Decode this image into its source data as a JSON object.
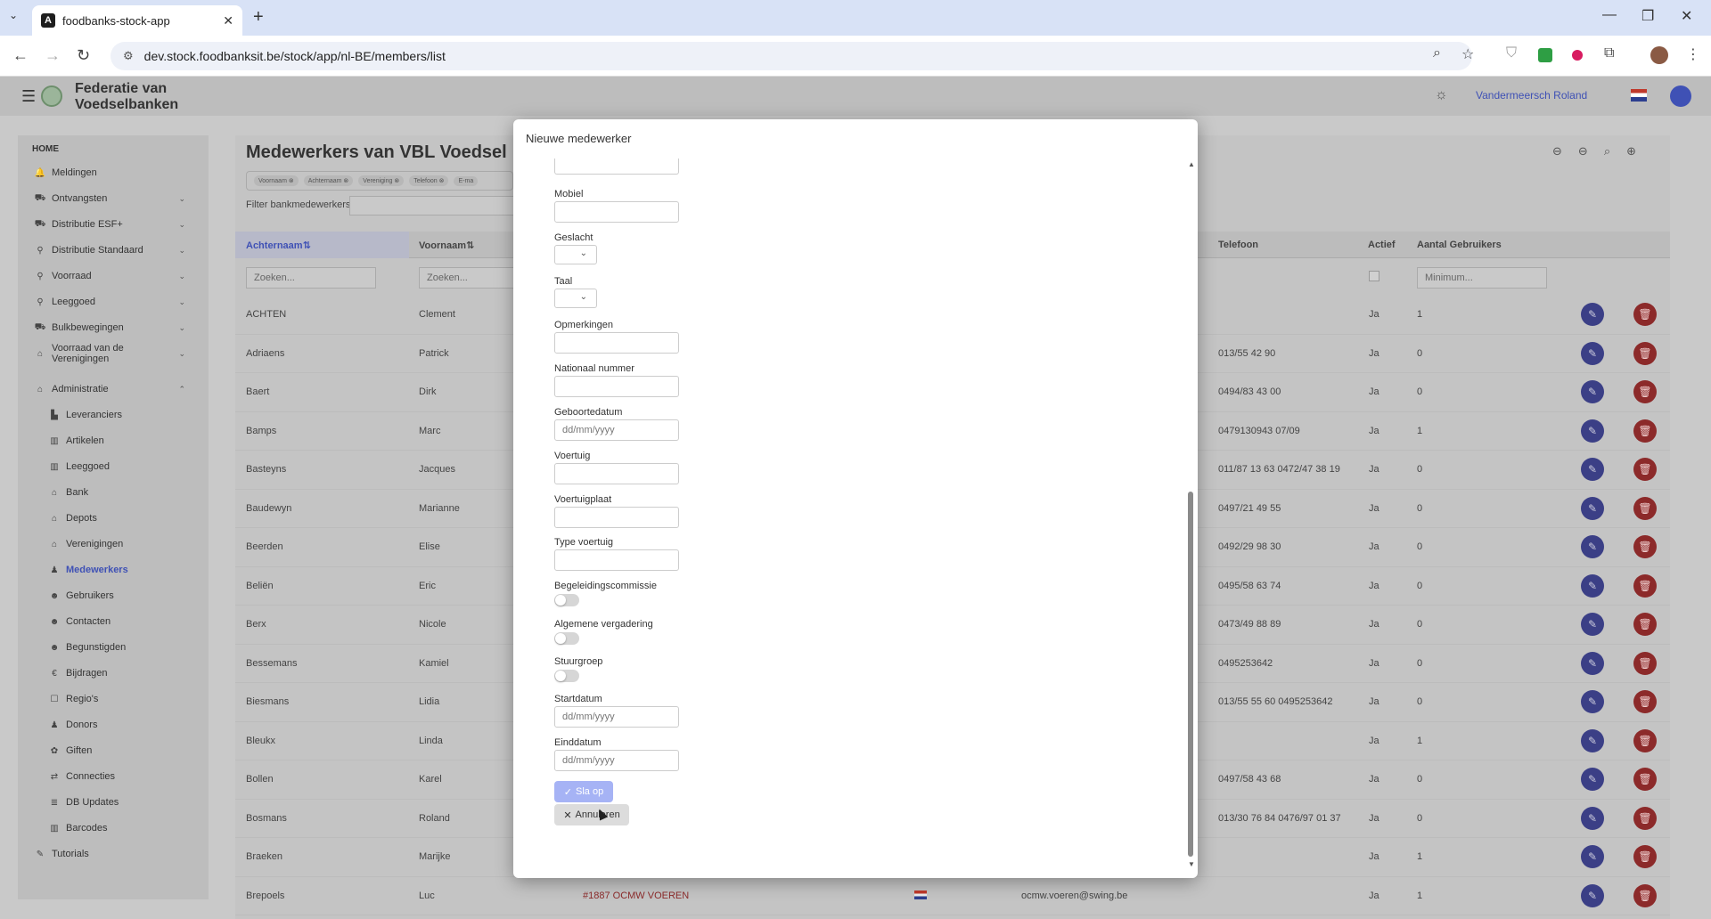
{
  "browser": {
    "tab_title": "foodbanks-stock-app",
    "tab_icon": "A",
    "url": "dev.stock.foodbanksit.be/stock/app/nl-BE/members/list"
  },
  "app": {
    "brand": "Federatie van Voedselbanken",
    "user_name": "Vandermeersch Roland"
  },
  "sidebar": {
    "home": "HOME",
    "items": [
      {
        "label": "Meldingen",
        "icon": "bell-icon",
        "chev": ""
      },
      {
        "label": "Ontvangsten",
        "icon": "truck-in-icon",
        "chev": "⌄"
      },
      {
        "label": "Distributie ESF+",
        "icon": "truck-icon",
        "chev": "⌄"
      },
      {
        "label": "Distributie Standaard",
        "icon": "dolly-icon",
        "chev": "⌄"
      },
      {
        "label": "Voorraad",
        "icon": "dolly-icon",
        "chev": "⌄"
      },
      {
        "label": "Leeggoed",
        "icon": "dolly-icon",
        "chev": "⌄"
      },
      {
        "label": "Bulkbewegingen",
        "icon": "truck-icon",
        "chev": "⌄"
      },
      {
        "label": "Voorraad van de Verenigingen",
        "icon": "warehouse-icon",
        "chev": "⌄"
      },
      {
        "label": "Administratie",
        "icon": "admin-icon",
        "chev": "⌃"
      },
      {
        "label": "Leveranciers",
        "icon": "industry-icon",
        "chev": ""
      },
      {
        "label": "Artikelen",
        "icon": "barcode-icon",
        "chev": ""
      },
      {
        "label": "Leeggoed",
        "icon": "barcode-icon",
        "chev": ""
      },
      {
        "label": "Bank",
        "icon": "warehouse-icon",
        "chev": ""
      },
      {
        "label": "Depots",
        "icon": "warehouse-icon",
        "chev": ""
      },
      {
        "label": "Verenigingen",
        "icon": "warehouse-icon",
        "chev": ""
      },
      {
        "label": "Medewerkers",
        "icon": "person-icon",
        "chev": ""
      },
      {
        "label": "Gebruikers",
        "icon": "users-icon",
        "chev": ""
      },
      {
        "label": "Contacten",
        "icon": "users-icon",
        "chev": ""
      },
      {
        "label": "Begunstigden",
        "icon": "users-icon",
        "chev": ""
      },
      {
        "label": "Bijdragen",
        "icon": "euro-icon",
        "chev": ""
      },
      {
        "label": "Regio's",
        "icon": "square-icon",
        "chev": ""
      },
      {
        "label": "Donors",
        "icon": "person-icon",
        "chev": ""
      },
      {
        "label": "Giften",
        "icon": "gift-icon",
        "chev": ""
      },
      {
        "label": "Connecties",
        "icon": "link-icon",
        "chev": ""
      },
      {
        "label": "DB Updates",
        "icon": "database-icon",
        "chev": ""
      },
      {
        "label": "Barcodes",
        "icon": "barcode-icon",
        "chev": ""
      },
      {
        "label": "Tutorials",
        "icon": "tutorial-icon",
        "chev": ""
      }
    ]
  },
  "main": {
    "title": "Medewerkers van VBL Voedsel",
    "chips": [
      "Voornaam",
      "Achternaam",
      "Vereniging",
      "Telefoon",
      "E-ma"
    ],
    "filter_label": "Filter bankmedewerkers",
    "columns": {
      "lastname": "Achternaam",
      "firstname": "Voornaam",
      "phone": "Telefoon",
      "active": "Actief",
      "users": "Aantal Gebruikers"
    },
    "search_placeholder": "Zoeken...",
    "min_placeholder": "Minimum...",
    "rows": [
      {
        "last": "ACHTEN",
        "first": "Clement",
        "phone": "",
        "active": "Ja",
        "users": "1"
      },
      {
        "last": "Adriaens",
        "first": "Patrick",
        "phone": "013/55 42 90",
        "active": "Ja",
        "users": "0"
      },
      {
        "last": "Baert",
        "first": "Dirk",
        "phone": "0494/83 43 00",
        "active": "Ja",
        "users": "0"
      },
      {
        "last": "Bamps",
        "first": "Marc",
        "phone": "0479130943 07/09",
        "active": "Ja",
        "users": "1"
      },
      {
        "last": "Basteyns",
        "first": "Jacques",
        "phone": "011/87 13 63 0472/47 38 19",
        "active": "Ja",
        "users": "0"
      },
      {
        "last": "Baudewyn",
        "first": "Marianne",
        "phone": "0497/21 49 55",
        "active": "Ja",
        "users": "0"
      },
      {
        "last": "Beerden",
        "first": "Elise",
        "phone": "0492/29 98 30",
        "active": "Ja",
        "users": "0"
      },
      {
        "last": "Beliën",
        "first": "Eric",
        "phone": "0495/58 63 74",
        "active": "Ja",
        "users": "0"
      },
      {
        "last": "Berx",
        "first": "Nicole",
        "phone": "0473/49 88 89",
        "active": "Ja",
        "users": "0"
      },
      {
        "last": "Bessemans",
        "first": "Kamiel",
        "phone": "0495253642",
        "active": "Ja",
        "users": "0"
      },
      {
        "last": "Biesmans",
        "first": "Lidia",
        "phone": "013/55 55 60 0495253642",
        "active": "Ja",
        "users": "0"
      },
      {
        "last": "Bleukx",
        "first": "Linda",
        "phone": "",
        "active": "Ja",
        "users": "1"
      },
      {
        "last": "Bollen",
        "first": "Karel",
        "phone": "0497/58 43 68",
        "active": "Ja",
        "users": "0"
      },
      {
        "last": "Bosmans",
        "first": "Roland",
        "phone": "013/30 76 84 0476/97 01 37",
        "active": "Ja",
        "users": "0"
      },
      {
        "last": "Braeken",
        "first": "Marijke",
        "phone": "",
        "active": "Ja",
        "users": "1"
      },
      {
        "last": "Brepoels",
        "first": "Luc",
        "phone": "",
        "active": "Ja",
        "users": "1"
      }
    ],
    "last_row_org": "#1887 OCMW VOEREN",
    "last_row_email": "ocmw.voeren@swing.be"
  },
  "modal": {
    "title": "Nieuwe medewerker",
    "fields": {
      "mobiel": "Mobiel",
      "geslacht": "Geslacht",
      "taal": "Taal",
      "opmerkingen": "Opmerkingen",
      "nationaal": "Nationaal nummer",
      "geboortedatum": "Geboortedatum",
      "voertuig": "Voertuig",
      "voertuigplaat": "Voertuigplaat",
      "type_voertuig": "Type voertuig",
      "begeleiding": "Begeleidingscommissie",
      "algemene": "Algemene vergadering",
      "stuurgroep": "Stuurgroep",
      "startdatum": "Startdatum",
      "einddatum": "Einddatum"
    },
    "date_placeholder": "dd/mm/yyyy",
    "save_label": "Sla op",
    "cancel_label": "Annuleren"
  }
}
